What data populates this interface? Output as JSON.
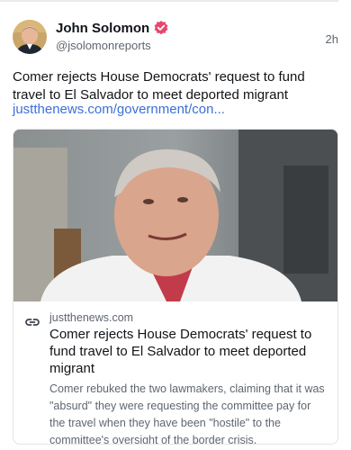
{
  "post": {
    "author_name": "John Solomon",
    "author_handle": "@jsolomonreports",
    "timestamp": "2h",
    "text": "Comer rejects House Democrats' request to fund travel to El Salvador to meet deported migrant",
    "link_text": "justthenews.com/government/con..."
  },
  "card": {
    "domain": "justthenews.com",
    "title": "Comer rejects House Democrats' request to fund travel to El Salvador to meet deported migrant",
    "description": "Comer rebuked the two lawmakers, claiming that it was \"absurd\" they were requesting the committee pay for the travel when they have been \"hostile\" to the committee's oversight of the border crisis."
  },
  "icons": {
    "verified": "verified-badge-icon",
    "link": "link-icon"
  },
  "colors": {
    "link": "#3b6fd8",
    "verified": "#e8476e",
    "muted_text": "#5f6670"
  }
}
